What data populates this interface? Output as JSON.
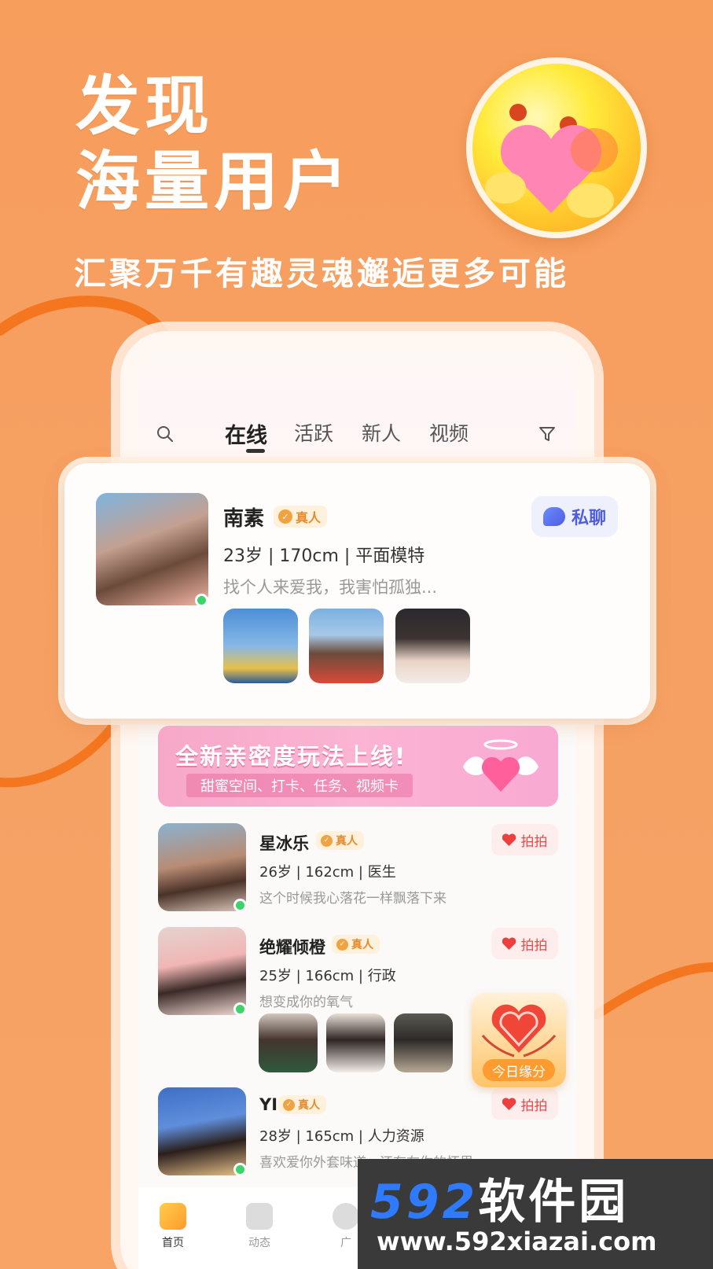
{
  "hero": {
    "title_line1": "发现",
    "title_line2": "海量用户",
    "subtitle": "汇聚万千有趣灵魂邂逅更多可能"
  },
  "tabs": [
    {
      "label": "在线",
      "active": true
    },
    {
      "label": "活跃",
      "active": false
    },
    {
      "label": "新人",
      "active": false
    },
    {
      "label": "视频",
      "active": false
    }
  ],
  "featured": {
    "name": "南素",
    "badge": "真人",
    "info": "23岁 | 170cm | 平面模特",
    "bio": "找个人来爱我，我害怕孤独...",
    "chat_label": "私聊",
    "online": true
  },
  "banner": {
    "title": "全新亲密度玩法上线!",
    "subtitle": "甜蜜空间、打卡、任务、视频卡"
  },
  "users": [
    {
      "name": "星冰乐",
      "badge": "真人",
      "info": "26岁 | 162cm | 医生",
      "bio": "这个时候我心落花一样飘落下来",
      "action": "拍拍"
    },
    {
      "name": "绝耀倾橙",
      "badge": "真人",
      "info": "25岁 | 166cm | 行政",
      "bio": "想变成你的氧气",
      "action": "拍拍"
    },
    {
      "name": "YI",
      "badge": "真人",
      "info": "28岁 | 165cm | 人力资源",
      "bio": "喜欢爱你外套味道，还有在你的怀里",
      "action": "拍拍"
    }
  ],
  "fate_widget": {
    "label": "今日缘分"
  },
  "bottom_nav": [
    {
      "label": "首页",
      "active": true
    },
    {
      "label": "动态",
      "active": false
    },
    {
      "label": "广",
      "active": false
    }
  ],
  "watermark": {
    "brand_num": "592",
    "brand_cn": "软件园",
    "url": "www.592xiazai.com"
  },
  "colors": {
    "background": "#f79e5d",
    "accent_orange": "#e8892a",
    "chat_blue": "#4e5dde",
    "like_red": "#ee3f3f",
    "online_green": "#3cd46a"
  }
}
